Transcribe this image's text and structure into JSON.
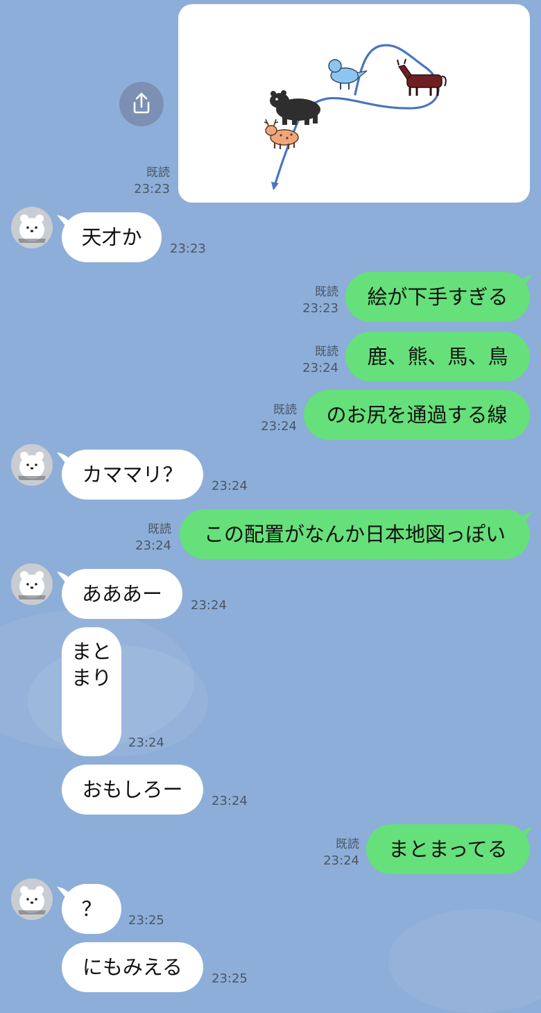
{
  "chat": {
    "image_message": {
      "read": "既読",
      "time": "23:23"
    },
    "messages": [
      {
        "text": "天才か",
        "time": "23:23"
      },
      {
        "text": "絵が下手すぎる",
        "read": "既読",
        "time": "23:23"
      },
      {
        "text": "鹿、熊、馬、鳥",
        "read": "既読",
        "time": "23:24"
      },
      {
        "text": "のお尻を通過する線",
        "read": "既読",
        "time": "23:24"
      },
      {
        "text": "カママリ？",
        "time": "23:24"
      },
      {
        "text": "この配置がなんか日本地図っぽい",
        "read": "既読",
        "time": "23:24"
      },
      {
        "text": "あああー",
        "time": "23:24"
      },
      {
        "text": "まとまり",
        "time": "23:24"
      },
      {
        "text": "おもしろー",
        "time": "23:24"
      },
      {
        "text": "まとまってる",
        "read": "既読",
        "time": "23:24"
      },
      {
        "text": "？",
        "time": "23:25"
      },
      {
        "text": "にもみえる",
        "time": "23:25"
      }
    ]
  },
  "icons": {
    "share": "share-icon",
    "avatar": "polar-bear-avatar"
  },
  "colors": {
    "background": "#8daed8",
    "incoming_bubble": "#ffffff",
    "outgoing_bubble": "#66e07a",
    "drawing_line": "#4a74c0"
  }
}
